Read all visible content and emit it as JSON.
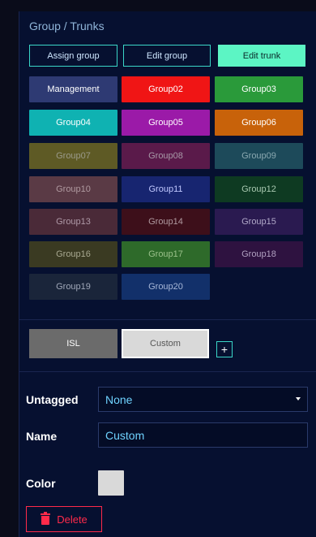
{
  "panel": {
    "title": "Group / Trunks"
  },
  "tabs": {
    "assign": "Assign group",
    "edit_group": "Edit group",
    "edit_trunk": "Edit trunk",
    "active_color": "#5cf5c4"
  },
  "groups": [
    {
      "label": "Management",
      "bg": "#2e3a73",
      "fg": "#ffffff"
    },
    {
      "label": "Group02",
      "bg": "#f01515",
      "fg": "#ffffff"
    },
    {
      "label": "Group03",
      "bg": "#2a9a3a",
      "fg": "#ffffff"
    },
    {
      "label": "Group04",
      "bg": "#0fb2b2",
      "fg": "#ffffff"
    },
    {
      "label": "Group05",
      "bg": "#9b1aa8",
      "fg": "#ffffff"
    },
    {
      "label": "Group06",
      "bg": "#c8620a",
      "fg": "#ffffff"
    },
    {
      "label": "Group07",
      "bg": "#5e5a25",
      "fg": "#9a9a8a"
    },
    {
      "label": "Group08",
      "bg": "#5a1a4a",
      "fg": "#a89aa8"
    },
    {
      "label": "Group09",
      "bg": "#1d4a5a",
      "fg": "#8aa8b0"
    },
    {
      "label": "Group10",
      "bg": "#5a3a45",
      "fg": "#b09aa0"
    },
    {
      "label": "Group11",
      "bg": "#172570",
      "fg": "#c0c8ff"
    },
    {
      "label": "Group12",
      "bg": "#0e3a22",
      "fg": "#a8c8b0"
    },
    {
      "label": "Group13",
      "bg": "#4a2a38",
      "fg": "#b09aa8"
    },
    {
      "label": "Group14",
      "bg": "#3d0f1a",
      "fg": "#b09aa0"
    },
    {
      "label": "Group15",
      "bg": "#2a1a50",
      "fg": "#b0a8c8"
    },
    {
      "label": "Group16",
      "bg": "#3a3a22",
      "fg": "#a8a890"
    },
    {
      "label": "Group17",
      "bg": "#2e6a2a",
      "fg": "#9ac08a"
    },
    {
      "label": "Group18",
      "bg": "#2e1240",
      "fg": "#b0a0c0"
    },
    {
      "label": "Group19",
      "bg": "#1a253a",
      "fg": "#a0a8b8"
    },
    {
      "label": "Group20",
      "bg": "#12306a",
      "fg": "#a8b8d8"
    }
  ],
  "trunks": {
    "isl": "ISL",
    "custom": "Custom",
    "add": "+"
  },
  "form": {
    "untagged_label": "Untagged",
    "untagged_value": "None",
    "name_label": "Name",
    "name_value": "Custom",
    "color_label": "Color",
    "color_value": "#d9d9d9"
  },
  "actions": {
    "delete": "Delete"
  }
}
